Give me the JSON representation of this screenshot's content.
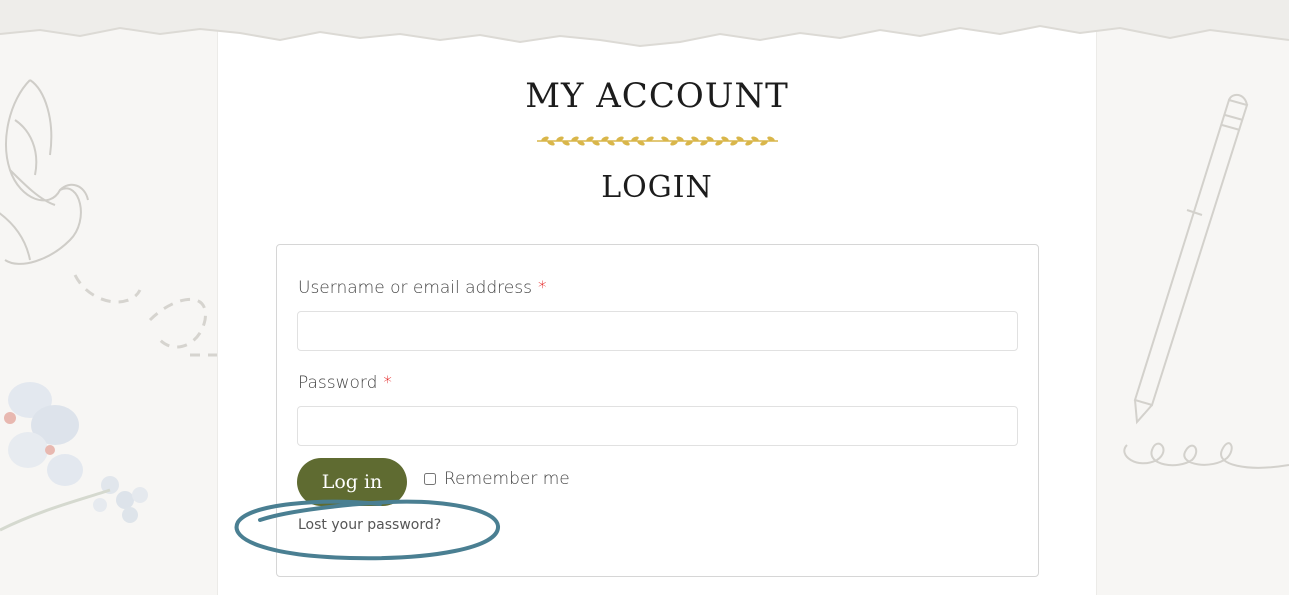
{
  "page": {
    "title": "MY ACCOUNT",
    "subtitle": "LOGIN"
  },
  "form": {
    "username_label": "Username or email address",
    "username_value": "",
    "password_label": "Password",
    "password_value": "",
    "required_marker": "*",
    "login_button": "Log in",
    "remember_label": "Remember me",
    "remember_checked": false,
    "lost_password": "Lost your password?"
  },
  "colors": {
    "login_button": "#5f6b31",
    "divider": "#d9b64a",
    "required": "#e00000",
    "highlight_circle": "#4a7f92"
  },
  "icons": {
    "divider": "laurel-divider-icon",
    "left_decoration": "butterfly-flower-decoration",
    "right_decoration": "pencil-decoration"
  }
}
